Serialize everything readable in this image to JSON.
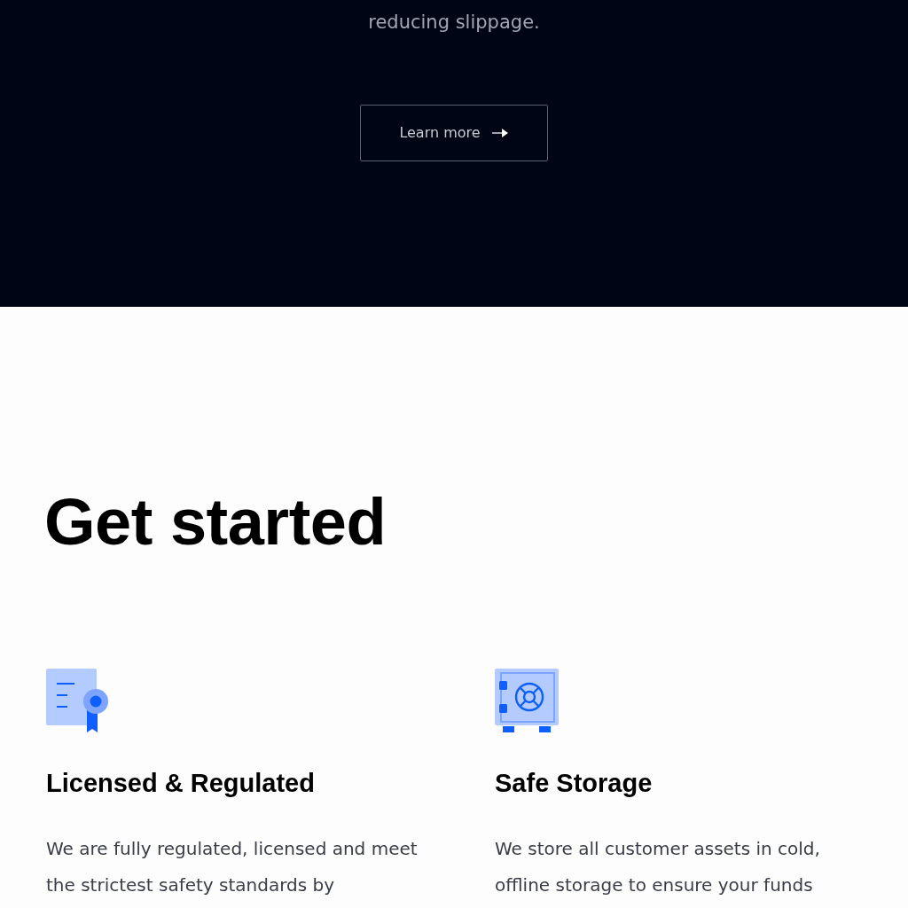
{
  "hero": {
    "text": "reducing slippage.",
    "button": "Learn more"
  },
  "section": {
    "title": "Get started",
    "features": [
      {
        "kind": "certificate",
        "title": "Licensed & Regulated",
        "text": "We are fully regulated, licensed and meet the strictest safety standards by"
      },
      {
        "kind": "safe",
        "title": "Safe Storage",
        "text": "We store all customer assets in cold, offline storage to ensure your funds"
      }
    ]
  }
}
